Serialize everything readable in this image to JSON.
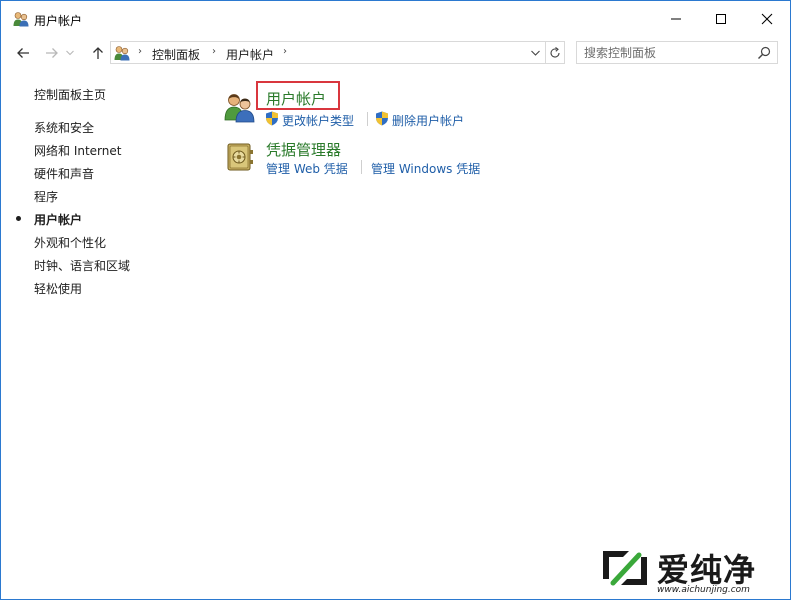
{
  "window": {
    "title": "用户帐户",
    "minimize_icon": "minimize-icon",
    "maximize_icon": "maximize-icon",
    "close_icon": "close-icon"
  },
  "nav": {
    "back_icon": "arrow-left-icon",
    "forward_icon": "arrow-right-icon",
    "recent_icon": "chevron-down-icon",
    "up_icon": "arrow-up-icon"
  },
  "address": {
    "segments": [
      "控制面板",
      "用户帐户"
    ],
    "separator": "›",
    "dropdown_icon": "chevron-down-icon",
    "refresh_icon": "refresh-icon"
  },
  "search": {
    "placeholder": "搜索控制面板"
  },
  "sidebar": {
    "home": "控制面板主页",
    "items": [
      {
        "label": "系统和安全",
        "active": false
      },
      {
        "label": "网络和 Internet",
        "active": false
      },
      {
        "label": "硬件和声音",
        "active": false
      },
      {
        "label": "程序",
        "active": false
      },
      {
        "label": "用户帐户",
        "active": true
      },
      {
        "label": "外观和个性化",
        "active": false
      },
      {
        "label": "时钟、语言和区域",
        "active": false
      },
      {
        "label": "轻松使用",
        "active": false
      }
    ]
  },
  "main": {
    "categories": [
      {
        "title": "用户帐户",
        "icon": "users-icon",
        "links": [
          {
            "label": "更改帐户类型",
            "shield": true
          },
          {
            "label": "删除用户帐户",
            "shield": true
          }
        ]
      },
      {
        "title": "凭据管理器",
        "icon": "credential-vault-icon",
        "links": [
          {
            "label": "管理 Web 凭据",
            "shield": false
          },
          {
            "label": "管理 Windows 凭据",
            "shield": false
          }
        ]
      }
    ]
  },
  "watermark": {
    "text": "爱纯净",
    "url": "www.aichunjing.com"
  },
  "colors": {
    "window_border": "#2b79d0",
    "category_title": "#2a7a2a",
    "link": "#1f5ea8",
    "highlight": "#d9363e"
  }
}
